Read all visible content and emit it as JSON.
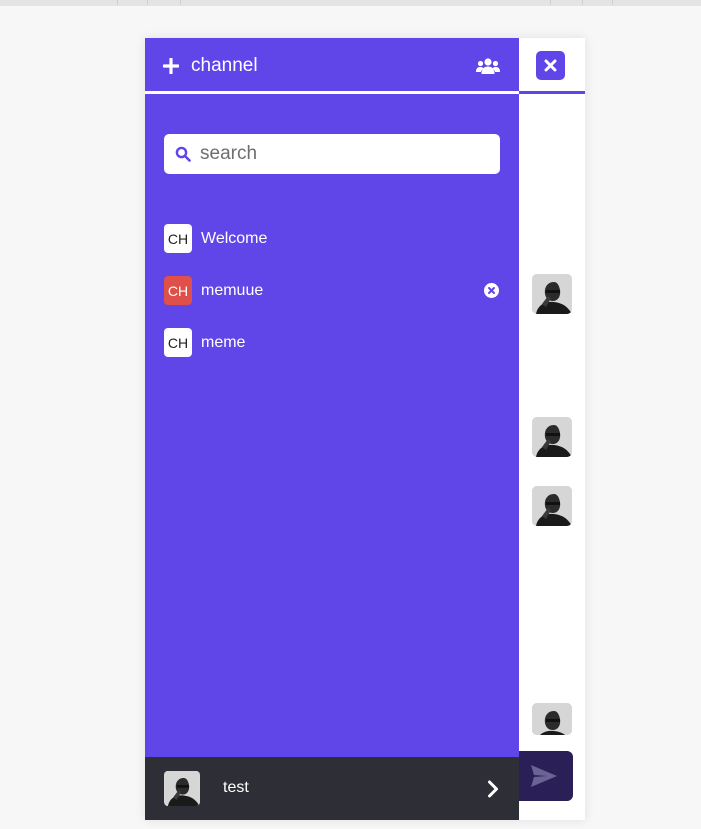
{
  "sidebar": {
    "add_channel_label": "channel",
    "search_placeholder": "search",
    "channels": [
      {
        "badge": "CH",
        "name": "Welcome"
      },
      {
        "badge": "CH",
        "name": "memuue"
      },
      {
        "badge": "CH",
        "name": "meme"
      }
    ]
  },
  "user": {
    "name": "test"
  },
  "colors": {
    "accent": "#6045e9",
    "active_badge": "#e0504a",
    "user_bar": "#2e2e36",
    "send_button": "#2a1f57"
  },
  "icons": [
    "plus-icon",
    "users-icon",
    "close-icon",
    "search-icon",
    "remove-channel-icon",
    "chevron-right-icon",
    "send-icon"
  ]
}
